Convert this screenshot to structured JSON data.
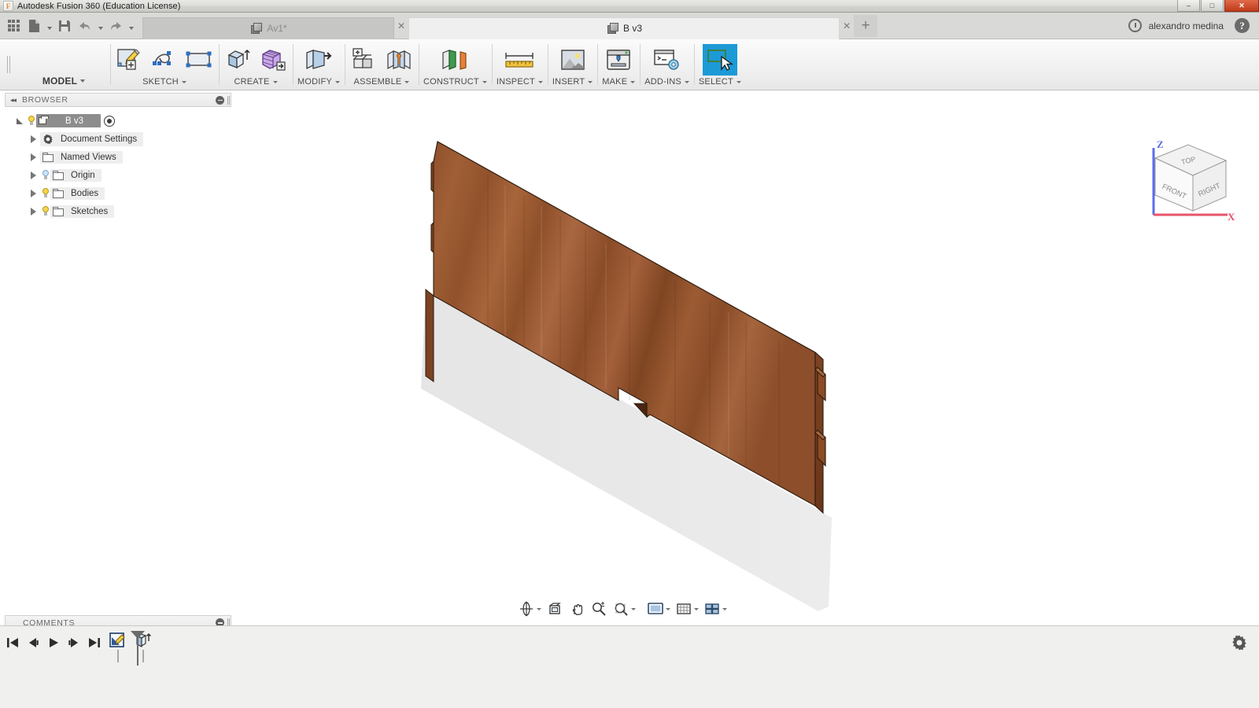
{
  "window": {
    "title": "Autodesk Fusion 360 (Education License)",
    "logo_letter": "F",
    "minimize_label": "–",
    "maximize_label": "□",
    "close_label": "✕"
  },
  "quick_access": {
    "apps_grid_name": "app-grid-icon",
    "new_label": "new-document-icon",
    "save_label": "save-icon",
    "undo_label": "undo-icon",
    "redo_label": "redo-icon"
  },
  "tabs": [
    {
      "label": "Av1*",
      "active": false,
      "close": "✕"
    },
    {
      "label": "B v3",
      "active": true,
      "close": "✕"
    }
  ],
  "tab_strip": {
    "new_tab_label": "+",
    "recent_icon": "clock-icon",
    "user_name": "alexandro medina",
    "help_label": "?"
  },
  "ribbon": {
    "workspace": "MODEL",
    "panels": [
      {
        "label": "SKETCH",
        "tools": [
          "create-sketch-icon",
          "spline-icon",
          "rectangle-icon"
        ]
      },
      {
        "label": "CREATE",
        "tools": [
          "extrude-icon",
          "pattern-box-icon"
        ]
      },
      {
        "label": "MODIFY",
        "tools": [
          "press-pull-icon"
        ]
      },
      {
        "label": "ASSEMBLE",
        "tools": [
          "new-component-icon",
          "joint-icon"
        ]
      },
      {
        "label": "CONSTRUCT",
        "tools": [
          "offset-plane-icon"
        ]
      },
      {
        "label": "INSPECT",
        "tools": [
          "measure-icon"
        ]
      },
      {
        "label": "INSERT",
        "tools": [
          "insert-image-icon"
        ]
      },
      {
        "label": "MAKE",
        "tools": [
          "3d-print-icon"
        ]
      },
      {
        "label": "ADD-INS",
        "tools": [
          "scripts-addins-icon"
        ]
      },
      {
        "label": "SELECT",
        "tools": [
          "select-window-icon"
        ],
        "active": true
      }
    ]
  },
  "browser": {
    "title": "BROWSER",
    "collapse_label": "◂◂",
    "nodes": [
      {
        "label": "B v3",
        "selected": true,
        "indent": 0,
        "icon": "document-cube-icon",
        "bulb": "on",
        "has_radio": true,
        "expander": "down"
      },
      {
        "label": "Document Settings",
        "selected": false,
        "indent": 1,
        "icon": "gear-icon",
        "bulb": "none",
        "expander": "right"
      },
      {
        "label": "Named Views",
        "selected": false,
        "indent": 1,
        "icon": "folder-icon",
        "bulb": "none",
        "expander": "right"
      },
      {
        "label": "Origin",
        "selected": false,
        "indent": 1,
        "icon": "folder-icon",
        "bulb": "blue",
        "expander": "right"
      },
      {
        "label": "Bodies",
        "selected": false,
        "indent": 1,
        "icon": "folder-icon",
        "bulb": "on",
        "expander": "right"
      },
      {
        "label": "Sketches",
        "selected": false,
        "indent": 1,
        "icon": "folder-icon",
        "bulb": "on",
        "expander": "right"
      }
    ]
  },
  "comments": {
    "title": "COMMENTS"
  },
  "viewcube": {
    "face_top": "TOP",
    "face_front": "FRONT",
    "face_right": "RIGHT",
    "axis_x": "X",
    "axis_z": "Z",
    "axis_x_color": "#e8536b",
    "axis_z_color": "#5b6ee8"
  },
  "navbar": {
    "buttons": [
      {
        "name": "orbit-icon",
        "has_caret": true
      },
      {
        "name": "look-at-icon",
        "has_caret": false
      },
      {
        "name": "pan-icon",
        "has_caret": false
      },
      {
        "name": "zoom-icon",
        "has_caret": false
      },
      {
        "name": "zoom-window-icon",
        "has_caret": true
      },
      {
        "name": "display-settings-icon",
        "has_caret": true
      },
      {
        "name": "grid-snaps-icon",
        "has_caret": true
      },
      {
        "name": "viewports-icon",
        "has_caret": true
      }
    ]
  },
  "timeline": {
    "controls": [
      "go-to-beginning-icon",
      "step-back-icon",
      "play-icon",
      "step-forward-icon",
      "go-to-end-icon"
    ],
    "features": [
      "sketch-feature-icon",
      "extrude-feature-icon"
    ],
    "marker_name": "timeline-marker",
    "settings_icon": "timeline-settings-gear-icon"
  },
  "model": {
    "body_name": "wooden-board-body",
    "material_color": "#9c5b35",
    "material_dark": "#6d3c22",
    "material_light": "#b06a3e",
    "shadow_color": "#d4d4d4"
  }
}
